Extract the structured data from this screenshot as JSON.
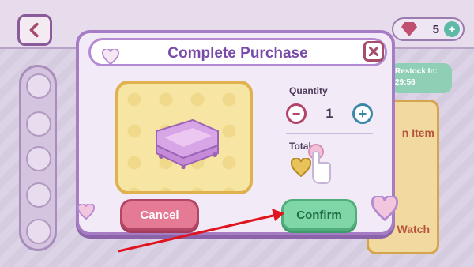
{
  "background": {
    "currency_value": "5",
    "restock_label": "Restock In:",
    "restock_time": "29:56",
    "right_card_top_label": "n Item",
    "right_card_bottom_label": "Watch"
  },
  "modal": {
    "title": "Complete Purchase",
    "quantity_label": "Quantity",
    "quantity_value": "1",
    "minus_symbol": "−",
    "plus_symbol": "+",
    "total_label": "Total",
    "cancel_label": "Cancel",
    "confirm_label": "Confirm"
  },
  "icons": {
    "back": "chevron-left-icon",
    "close": "close-icon",
    "heart": "heart-icon",
    "coin": "heart-coin-icon",
    "gem": "gem-icon",
    "cursor": "hand-pointer-icon"
  },
  "colors": {
    "modal_border": "#a67cc4",
    "title": "#7a4aa8",
    "cancel": "#e57a94",
    "confirm": "#7fd6a6",
    "preview_frame": "#dfb24f",
    "arrow": "#e0141e"
  }
}
